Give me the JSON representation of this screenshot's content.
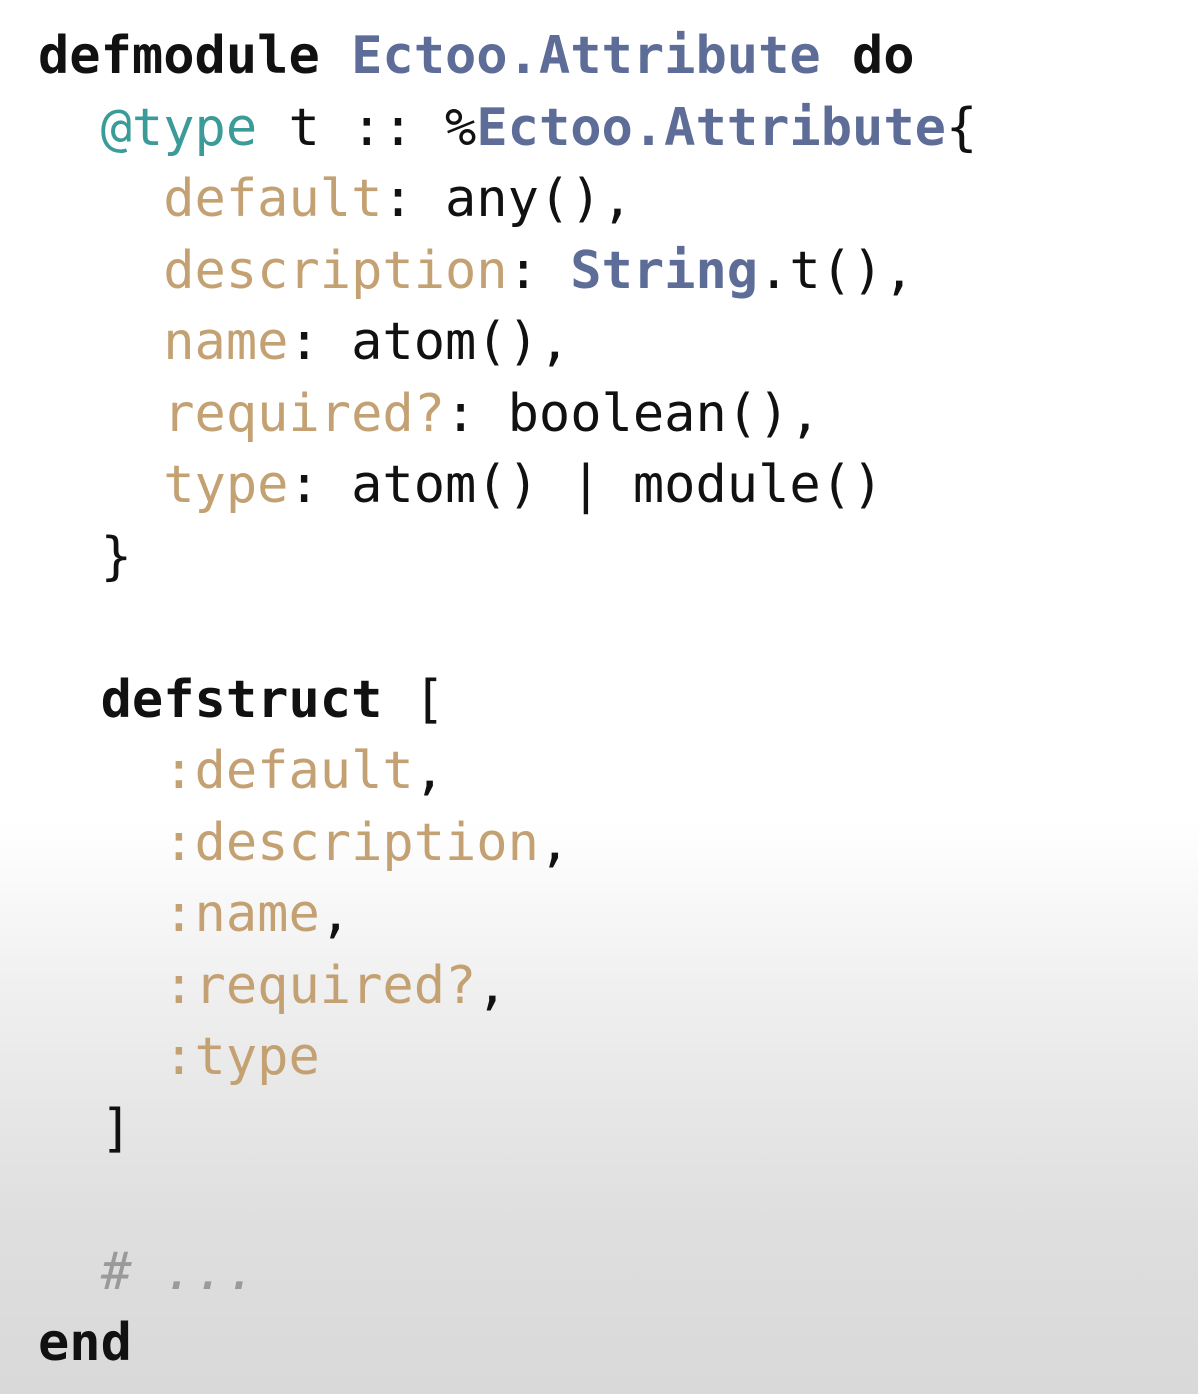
{
  "code": {
    "language": "Elixir",
    "lines": [
      {
        "indent": "",
        "tokens": [
          {
            "t": "defmodule",
            "c": "kw"
          },
          {
            "t": " ",
            "c": "plain"
          },
          {
            "t": "Ectoo.Attribute",
            "c": "mod"
          },
          {
            "t": " ",
            "c": "plain"
          },
          {
            "t": "do",
            "c": "kw"
          }
        ]
      },
      {
        "indent": "  ",
        "tokens": [
          {
            "t": "@type",
            "c": "attr"
          },
          {
            "t": " t :: %",
            "c": "plain"
          },
          {
            "t": "Ectoo.Attribute",
            "c": "mod"
          },
          {
            "t": "{",
            "c": "plain"
          }
        ]
      },
      {
        "indent": "    ",
        "tokens": [
          {
            "t": "default",
            "c": "key"
          },
          {
            "t": ": any(),",
            "c": "plain"
          }
        ]
      },
      {
        "indent": "    ",
        "tokens": [
          {
            "t": "description",
            "c": "key"
          },
          {
            "t": ": ",
            "c": "plain"
          },
          {
            "t": "String",
            "c": "mod"
          },
          {
            "t": ".t(),",
            "c": "plain"
          }
        ]
      },
      {
        "indent": "    ",
        "tokens": [
          {
            "t": "name",
            "c": "key"
          },
          {
            "t": ": atom(),",
            "c": "plain"
          }
        ]
      },
      {
        "indent": "    ",
        "tokens": [
          {
            "t": "required?",
            "c": "key"
          },
          {
            "t": ": boolean(),",
            "c": "plain"
          }
        ]
      },
      {
        "indent": "    ",
        "tokens": [
          {
            "t": "type",
            "c": "key"
          },
          {
            "t": ": atom() | module()",
            "c": "plain"
          }
        ]
      },
      {
        "indent": "  ",
        "tokens": [
          {
            "t": "}",
            "c": "plain"
          }
        ]
      },
      {
        "indent": "",
        "tokens": []
      },
      {
        "indent": "  ",
        "tokens": [
          {
            "t": "defstruct",
            "c": "kw"
          },
          {
            "t": " [",
            "c": "plain"
          }
        ]
      },
      {
        "indent": "    ",
        "tokens": [
          {
            "t": ":default",
            "c": "atom"
          },
          {
            "t": ",",
            "c": "plain"
          }
        ]
      },
      {
        "indent": "    ",
        "tokens": [
          {
            "t": ":description",
            "c": "atom"
          },
          {
            "t": ",",
            "c": "plain"
          }
        ]
      },
      {
        "indent": "    ",
        "tokens": [
          {
            "t": ":name",
            "c": "atom"
          },
          {
            "t": ",",
            "c": "plain"
          }
        ]
      },
      {
        "indent": "    ",
        "tokens": [
          {
            "t": ":required?",
            "c": "atom"
          },
          {
            "t": ",",
            "c": "plain"
          }
        ]
      },
      {
        "indent": "    ",
        "tokens": [
          {
            "t": ":type",
            "c": "atom"
          }
        ]
      },
      {
        "indent": "  ",
        "tokens": [
          {
            "t": "]",
            "c": "plain"
          }
        ]
      },
      {
        "indent": "",
        "tokens": []
      },
      {
        "indent": "  ",
        "tokens": [
          {
            "t": "# ...",
            "c": "comment"
          }
        ]
      },
      {
        "indent": "",
        "tokens": [
          {
            "t": "end",
            "c": "kw"
          }
        ]
      }
    ]
  },
  "colors": {
    "keyword": "#111111",
    "module": "#5d6d97",
    "attribute": "#3b9b98",
    "key_atom": "#c4a173",
    "comment": "#9a9a9a"
  }
}
